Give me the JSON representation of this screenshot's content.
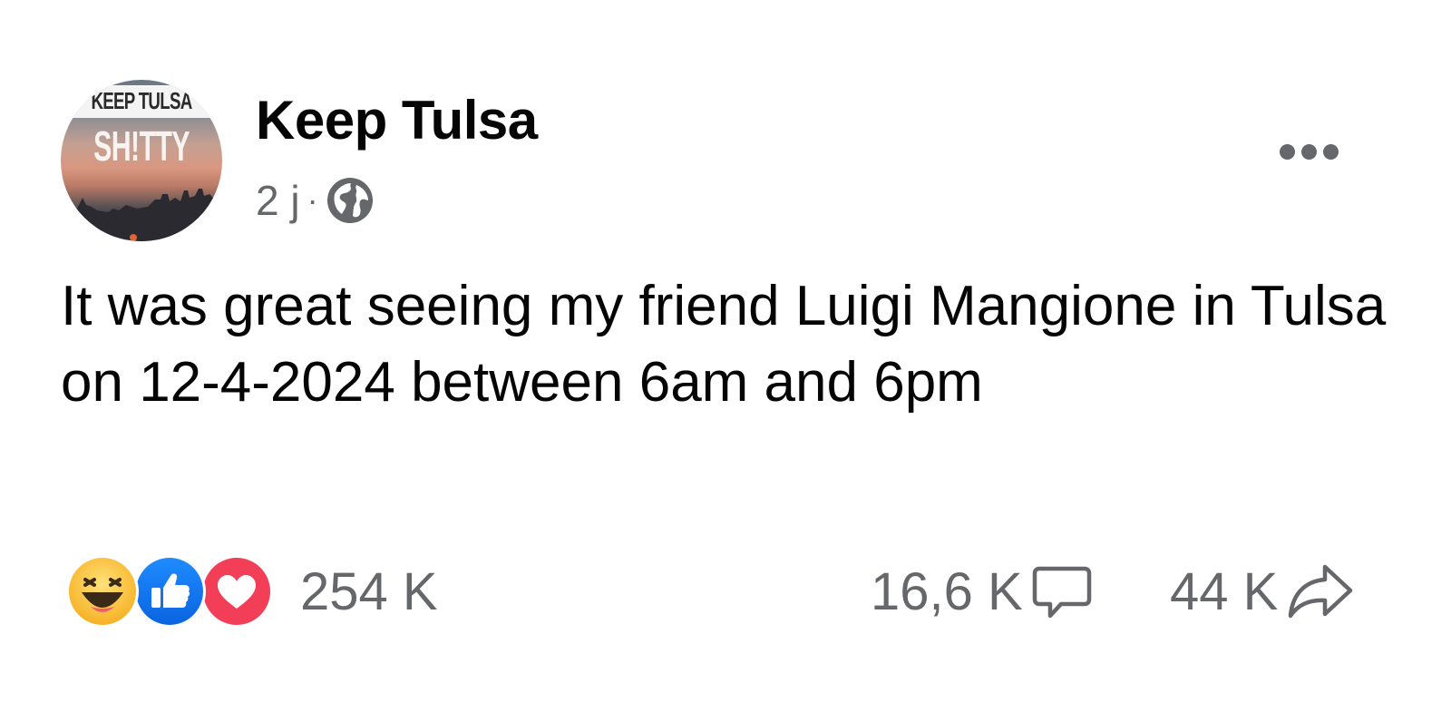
{
  "post": {
    "author": {
      "name": "Keep Tulsa",
      "avatar_text_top": "KEEP TULSA",
      "avatar_text_main": "SH!TTY"
    },
    "time": "2 j",
    "separator": "·",
    "privacy_icon": "globe-icon",
    "more_icon": "more-options-icon",
    "text": "It was great seeing my friend Luigi Mangione in Tulsa on 12-4-2024 between 6am and 6pm",
    "reactions": {
      "types": [
        "haha",
        "like",
        "love"
      ],
      "count": "254 K"
    },
    "comments_count": "16,6 K",
    "comments_icon": "comment-icon",
    "shares_count": "44 K",
    "shares_icon": "share-icon"
  },
  "colors": {
    "text_primary": "#050505",
    "text_secondary": "#65676b",
    "like_blue": "#1877f2",
    "love_red": "#f33e58",
    "haha_yellow": "#f7b125"
  }
}
